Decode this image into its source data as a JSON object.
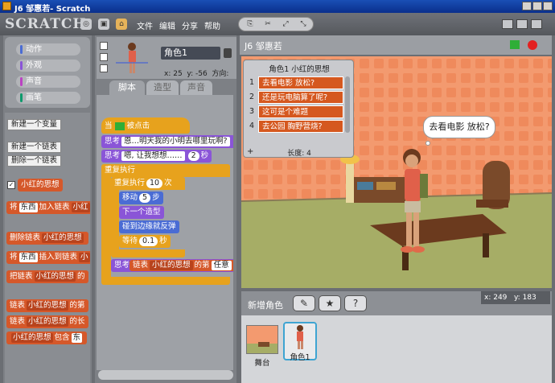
{
  "window": {
    "title": "J6 邹惠若- Scratch"
  },
  "app": {
    "logo": "SCRATCH"
  },
  "menu": {
    "file": "文件",
    "edit": "编辑",
    "share": "分享",
    "help": "帮助"
  },
  "categories": [
    {
      "label": "动作",
      "color": "#4a6cd4"
    },
    {
      "label": "外观",
      "color": "#8a55d7"
    },
    {
      "label": "声音",
      "color": "#bb42c3"
    },
    {
      "label": "画笔",
      "color": "#0e9a6c"
    }
  ],
  "palette": {
    "new_var": "新建一个变量",
    "new_list": "新建一个链表",
    "delete_list": "删除一个链表",
    "list_name": "小红的思想",
    "add_block": {
      "pre": "将",
      "slot": "东西",
      "mid": "加入链表",
      "drop": "小红"
    },
    "delete_block": {
      "pre": "删除链表",
      "drop": "小红的思想"
    },
    "insert_block": {
      "pre": "将",
      "slot": "东西",
      "mid": "插入到链表",
      "drop": "小"
    },
    "replace_block": {
      "pre": "把链表",
      "drop": "小红的思想",
      "post": "的"
    },
    "item_block": {
      "pre": "链表",
      "drop": "小红的思想",
      "post": "的第"
    },
    "length_block": {
      "pre": "链表",
      "drop": "小红的思想",
      "post": "的长"
    },
    "contains_block": {
      "drop": "小红的思想",
      "post": "包含",
      "slot": "东"
    }
  },
  "sprite": {
    "name": "角色1",
    "x_label": "x: 25",
    "y_label": "y: -56",
    "dir_label": "方向:"
  },
  "tabs": [
    {
      "label": "脚本"
    },
    {
      "label": "造型"
    },
    {
      "label": "声音"
    }
  ],
  "script": {
    "when_flag_pre": "当",
    "when_flag_post": "被点击",
    "think1_pre": "思考",
    "think1_text": "恩…明天我的小明去哪里玩啊?",
    "think2_pre": "思考",
    "think2_text": "嗯, 让我想想……",
    "think2_n": "2",
    "think2_unit": "秒",
    "forever": "重复执行",
    "repeat_pre": "重复执行",
    "repeat_n": "10",
    "repeat_unit": "次",
    "move_pre": "移动",
    "move_n": "5",
    "move_unit": "步",
    "next_costume": "下一个造型",
    "bounce": "碰到边缘就反弹",
    "wait_pre": "等待",
    "wait_n": "0.1",
    "wait_unit": "秒",
    "think3_pre": "思考",
    "think3_mid": "链表",
    "think3_list": "小红的思想",
    "think3_of": "的第",
    "think3_item": "任意"
  },
  "stage": {
    "title": "J6 邹惠若",
    "bubble": "去看电影 放松?",
    "list_monitor": {
      "title": "角色1 小红的思想",
      "items": [
        "去看电影 放松?",
        "还是玩电脑算了呢?",
        "这可是个难题",
        "去公园 胸野营烧?"
      ],
      "length_label": "长度: 4",
      "add": "+"
    }
  },
  "bottom": {
    "new_sprite": "新增角色",
    "mouse_x": "x: 249",
    "mouse_y": "y: 183",
    "stage_label": "舞台",
    "sprite_label": "角色1"
  }
}
